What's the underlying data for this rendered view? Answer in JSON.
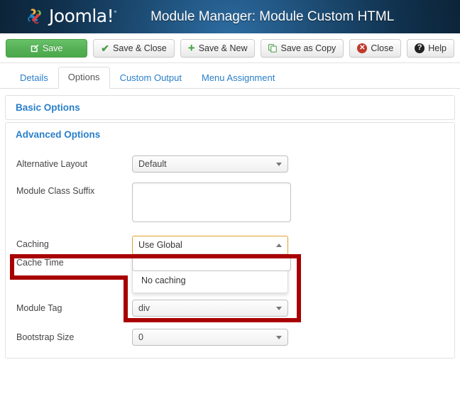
{
  "header": {
    "brand": "Joomla!",
    "brand_mark": "°",
    "title": "Module Manager: Module Custom HTML",
    "logo_icon": "joomla-logo-icon",
    "colors": {
      "bg_dark": "#0c2438",
      "bg_light": "#2d6da3"
    }
  },
  "toolbar": {
    "buttons": [
      {
        "label": "Save",
        "icon": "pencil-icon",
        "style": "primary"
      },
      {
        "label": "Save & Close",
        "icon": "check-icon",
        "style": "default"
      },
      {
        "label": "Save & New",
        "icon": "plus-icon",
        "style": "default"
      },
      {
        "label": "Save as Copy",
        "icon": "copy-icon",
        "style": "default"
      },
      {
        "label": "Close",
        "icon": "close-circle-icon",
        "style": "default"
      },
      {
        "label": "Help",
        "icon": "help-circle-icon",
        "style": "default"
      }
    ],
    "save_color": "#55b055"
  },
  "tabs": [
    {
      "label": "Details",
      "active": false
    },
    {
      "label": "Options",
      "active": true
    },
    {
      "label": "Custom Output",
      "active": false
    },
    {
      "label": "Menu Assignment",
      "active": false
    }
  ],
  "panels": {
    "basic": {
      "title": "Basic Options"
    },
    "advanced": {
      "title": "Advanced Options",
      "fields": {
        "alternative_layout": {
          "label": "Alternative Layout",
          "value": "Default",
          "control": "select"
        },
        "module_class_suffix": {
          "label": "Module Class Suffix",
          "value": "",
          "placeholder": "",
          "control": "textarea"
        },
        "caching": {
          "label": "Caching",
          "value": "Use Global",
          "control": "select-open",
          "open": true,
          "options": [
            "Use Global",
            "No caching"
          ]
        },
        "cache_time": {
          "label": "Cache Time",
          "value": "",
          "control": "text"
        },
        "module_tag": {
          "label": "Module Tag",
          "value": "div",
          "control": "select"
        },
        "bootstrap_size": {
          "label": "Bootstrap Size",
          "value": "0",
          "control": "select"
        }
      }
    }
  },
  "annotation": {
    "name": "caching-highlight",
    "color": "#a80000",
    "shape": "stepped-rectangle"
  }
}
